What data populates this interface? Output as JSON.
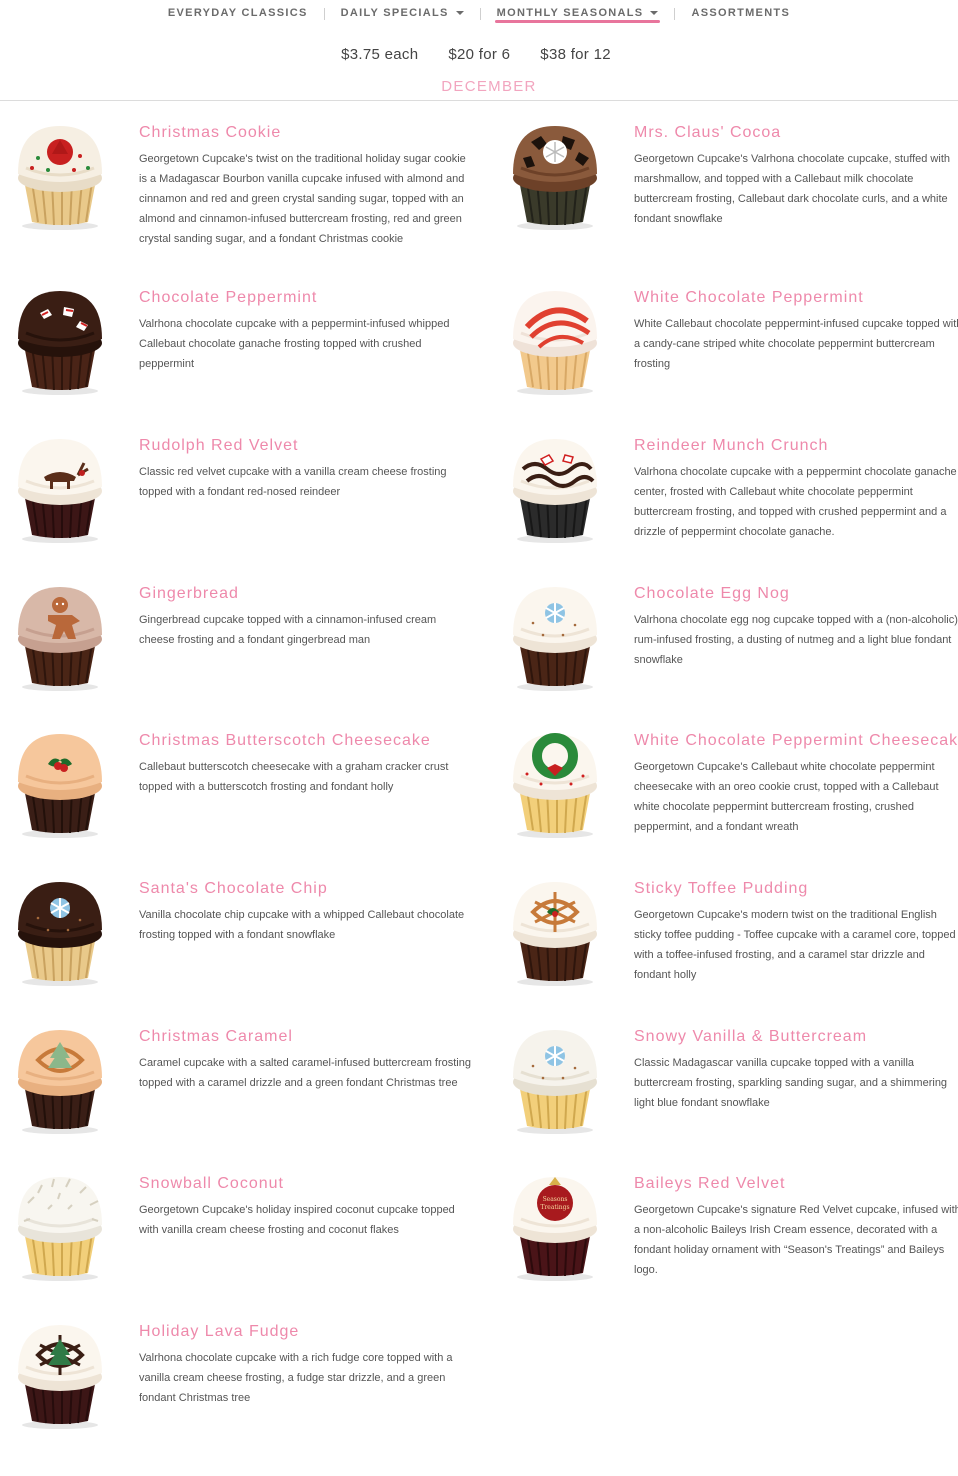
{
  "nav": {
    "items": [
      {
        "label": "EVERYDAY CLASSICS",
        "dropdown": false,
        "active": false
      },
      {
        "label": "DAILY SPECIALS",
        "dropdown": true,
        "active": false
      },
      {
        "label": "MONTHLY SEASONALS",
        "dropdown": true,
        "active": true
      },
      {
        "label": "ASSORTMENTS",
        "dropdown": false,
        "active": false
      }
    ]
  },
  "prices": [
    "$3.75 each",
    "$20 for 6",
    "$38 for 12"
  ],
  "month": "DECEMBER",
  "colors": {
    "accent": "#ee89ab",
    "month": "#f2a5bf",
    "text": "#555555"
  },
  "products": [
    {
      "name": "Christmas Cookie",
      "description": "Georgetown Cupcake's twist on the traditional holiday sugar cookie is a Madagascar Bourbon vanilla cupcake infused with almond and cinnamon and red and green crystal sanding sugar, topped with an almond and cinnamon-infused buttercream frosting, red and green crystal sanding sugar, and a fondant Christmas cookie",
      "image": "cupcake-christmas-cookie"
    },
    {
      "name": "Mrs. Claus' Cocoa",
      "description": "Georgetown Cupcake's Valrhona chocolate cupcake, stuffed with marshmallow, and topped with a Callebaut milk chocolate buttercream frosting, Callebaut dark chocolate curls, and a white fondant snowflake",
      "image": "cupcake-mrs-claus-cocoa"
    },
    {
      "name": "Chocolate Peppermint",
      "description": "Valrhona chocolate cupcake with a peppermint-infused whipped Callebaut chocolate ganache frosting topped with crushed peppermint",
      "image": "cupcake-chocolate-peppermint"
    },
    {
      "name": "White Chocolate Peppermint",
      "description": "White Callebaut chocolate peppermint-infused cupcake topped with a candy-cane striped white chocolate peppermint buttercream frosting",
      "image": "cupcake-white-chocolate-peppermint"
    },
    {
      "name": "Rudolph Red Velvet",
      "description": "Classic red velvet cupcake with a vanilla cream cheese frosting topped with a fondant red-nosed reindeer",
      "image": "cupcake-rudolph-red-velvet"
    },
    {
      "name": "Reindeer Munch Crunch",
      "description": "Valrhona chocolate cupcake with a peppermint chocolate ganache center, frosted with Callebaut white chocolate peppermint buttercream frosting, and topped with crushed peppermint and a drizzle of peppermint chocolate ganache.",
      "image": "cupcake-reindeer-munch-crunch"
    },
    {
      "name": "Gingerbread",
      "description": "Gingerbread cupcake topped with a cinnamon-infused cream cheese frosting and a fondant gingerbread man",
      "image": "cupcake-gingerbread"
    },
    {
      "name": "Chocolate Egg Nog",
      "description": "Valrhona chocolate egg nog cupcake topped with a (non-alcoholic) rum-infused frosting, a dusting of nutmeg and a light blue fondant snowflake",
      "image": "cupcake-chocolate-egg-nog"
    },
    {
      "name": "Christmas Butterscotch Cheesecake",
      "description": "Callebaut butterscotch cheesecake with a graham cracker crust topped with a butterscotch frosting and fondant holly",
      "image": "cupcake-christmas-butterscotch-cheesecake"
    },
    {
      "name": "White Chocolate Peppermint Cheesecake",
      "description": "Georgetown Cupcake's Callebaut white chocolate peppermint cheesecake with an oreo cookie crust, topped with a Callebaut white chocolate peppermint buttercream frosting, crushed peppermint, and a fondant wreath",
      "image": "cupcake-white-chocolate-peppermint-cheesecake"
    },
    {
      "name": "Santa's Chocolate Chip",
      "description": "Vanilla chocolate chip cupcake with a whipped Callebaut chocolate frosting topped with a fondant snowflake",
      "image": "cupcake-santas-chocolate-chip"
    },
    {
      "name": "Sticky Toffee Pudding",
      "description": "Georgetown Cupcake's modern twist on the traditional English sticky toffee pudding - Toffee cupcake with a caramel core, topped with a toffee-infused frosting, and a caramel star drizzle and fondant holly",
      "image": "cupcake-sticky-toffee-pudding"
    },
    {
      "name": "Christmas Caramel",
      "description": "Caramel cupcake with a salted caramel-infused buttercream frosting topped with a caramel drizzle and a green fondant Christmas tree",
      "image": "cupcake-christmas-caramel"
    },
    {
      "name": "Snowy Vanilla & Buttercream",
      "description": "Classic Madagascar vanilla cupcake topped with a vanilla buttercream frosting, sparkling sanding sugar, and a shimmering light blue fondant snowflake",
      "image": "cupcake-snowy-vanilla-buttercream"
    },
    {
      "name": "Snowball Coconut",
      "description": "Georgetown Cupcake's holiday inspired coconut cupcake topped with vanilla cream cheese frosting and coconut flakes",
      "image": "cupcake-snowball-coconut"
    },
    {
      "name": "Baileys Red Velvet",
      "description": "Georgetown Cupcake's signature Red Velvet cupcake, infused with a non-alcoholic Baileys Irish Cream essence, decorated with a fondant holiday ornament with “Season's Treatings” and Baileys logo.",
      "image": "cupcake-baileys-red-velvet"
    },
    {
      "name": "Holiday Lava Fudge",
      "description": "Valrhona chocolate cupcake with a rich fudge core topped with a vanilla cream cheese frosting, a fudge star drizzle, and a green fondant Christmas tree",
      "image": "cupcake-holiday-lava-fudge"
    }
  ],
  "ornament_text": "Seasons Treatings"
}
